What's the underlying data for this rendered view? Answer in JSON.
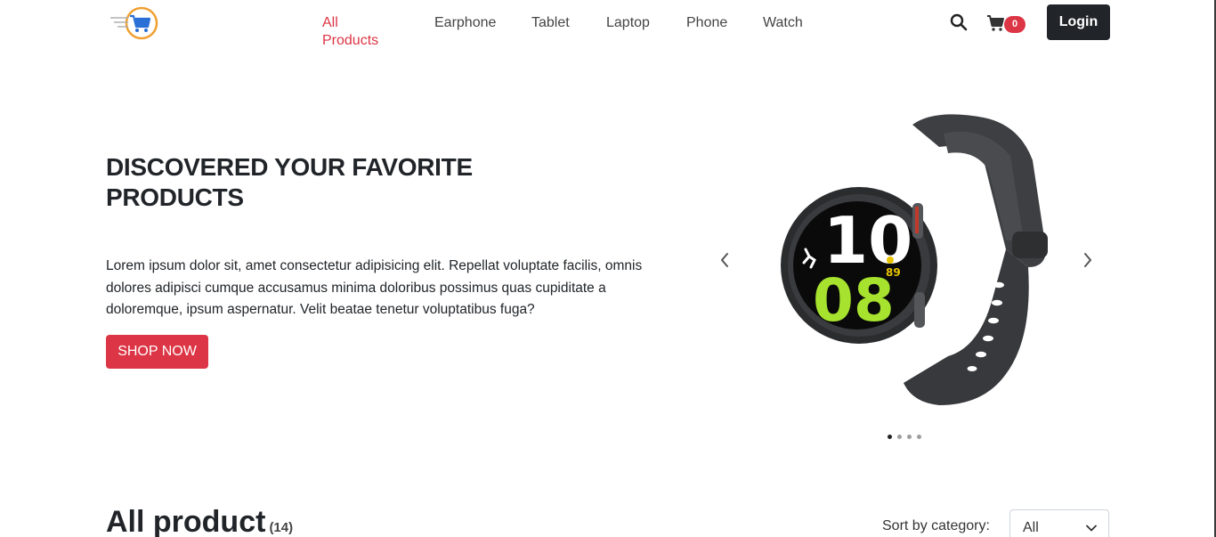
{
  "nav": {
    "items": [
      {
        "label": "All Products",
        "active": true
      },
      {
        "label": "Earphone"
      },
      {
        "label": "Tablet"
      },
      {
        "label": "Laptop"
      },
      {
        "label": "Phone"
      },
      {
        "label": "Watch"
      }
    ]
  },
  "header": {
    "logo_icon": "shopping-cart-logo",
    "search_icon": "search-icon",
    "cart_icon": "cart-icon",
    "cart_count": "0",
    "login_label": "Login"
  },
  "hero": {
    "title": "DISCOVERED YOUR FAVORITE PRODUCTS",
    "text": "Lorem ipsum dolor sit, amet consectetur adipisicing elit. Repellat voluptate facilis, omnis dolores adipisci cumque accusamus minima doloribus possimus quas cupiditate a doloremque, ipsum aspernatur. Velit beatae tenetur voluptatibus fuga?",
    "button_label": "SHOP NOW"
  },
  "carousel": {
    "slide_count": 4,
    "active_index": 0,
    "watch_time_hours": "10",
    "watch_time_minutes": "08",
    "watch_heart": "89"
  },
  "products": {
    "title": "All product",
    "count": "(14)",
    "sort_label": "Sort by category:",
    "sort_value": "All"
  },
  "colors": {
    "accent": "#dc3545",
    "dark": "#212529"
  }
}
